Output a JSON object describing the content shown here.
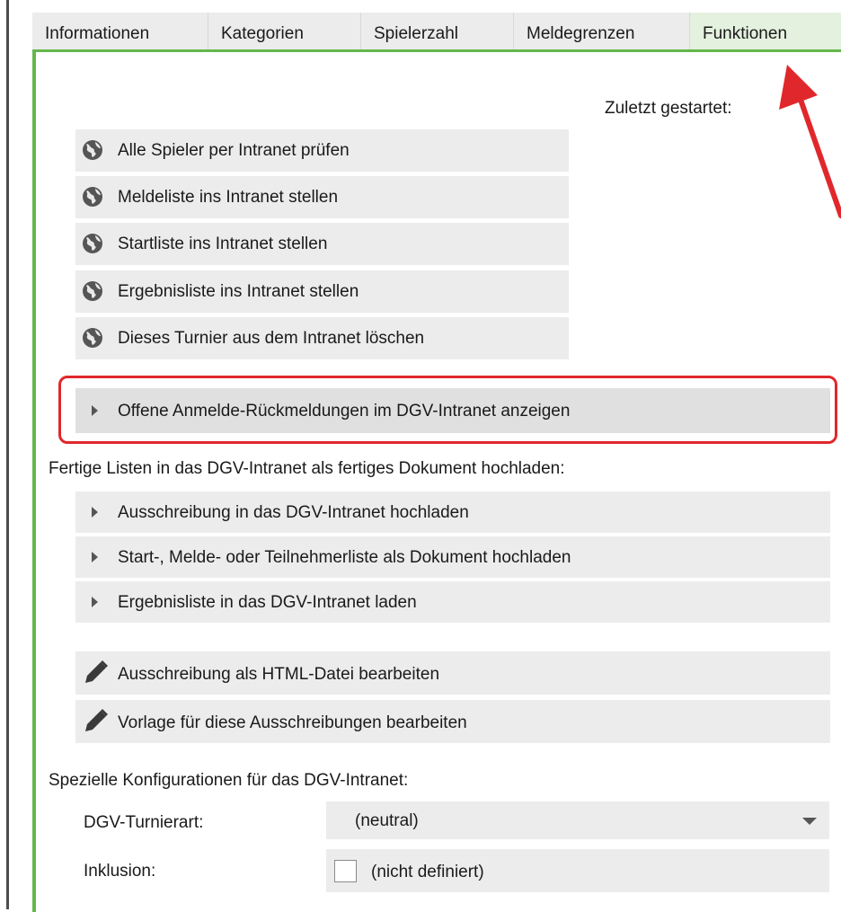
{
  "tabs": [
    {
      "label": "Informationen"
    },
    {
      "label": "Kategorien"
    },
    {
      "label": "Spielerzahl"
    },
    {
      "label": "Meldegrenzen"
    },
    {
      "label": "Funktionen"
    }
  ],
  "last_started_label": "Zuletzt gestartet:",
  "intranet_buttons": [
    {
      "label": "Alle Spieler per Intranet prüfen",
      "icon": "globe-icon"
    },
    {
      "label": "Meldeliste ins Intranet stellen",
      "icon": "globe-icon"
    },
    {
      "label": "Startliste ins Intranet stellen",
      "icon": "globe-icon"
    },
    {
      "label": "Ergebnisliste ins Intranet stellen",
      "icon": "globe-icon"
    },
    {
      "label": "Dieses Turnier aus dem Intranet löschen",
      "icon": "globe-icon"
    }
  ],
  "open_registrations_button": {
    "label": "Offene Anmelde-Rückmeldungen im DGV-Intranet anzeigen"
  },
  "upload_section": {
    "heading": "Fertige Listen in das DGV-Intranet als fertiges Dokument hochladen:",
    "buttons": [
      {
        "label": "Ausschreibung in das DGV-Intranet hochladen"
      },
      {
        "label": "Start-, Melde- oder Teilnehmerliste als Dokument hochladen"
      },
      {
        "label": "Ergebnisliste in das DGV-Intranet laden"
      }
    ]
  },
  "edit_buttons": [
    {
      "label": "Ausschreibung als HTML-Datei bearbeiten",
      "icon": "pencil-icon"
    },
    {
      "label": "Vorlage für diese Ausschreibungen bearbeiten",
      "icon": "pencil-icon"
    }
  ],
  "config_section": {
    "heading": "Spezielle Konfigurationen für das DGV-Intranet:",
    "tournament_type_label": "DGV-Turnierart:",
    "tournament_type_value": "(neutral)",
    "inclusion_label": "Inklusion:",
    "inclusion_value": "(nicht definiert)"
  },
  "colors": {
    "accent_green": "#63b74a",
    "highlight_red": "#e0282c",
    "button_bg": "#ececec"
  }
}
